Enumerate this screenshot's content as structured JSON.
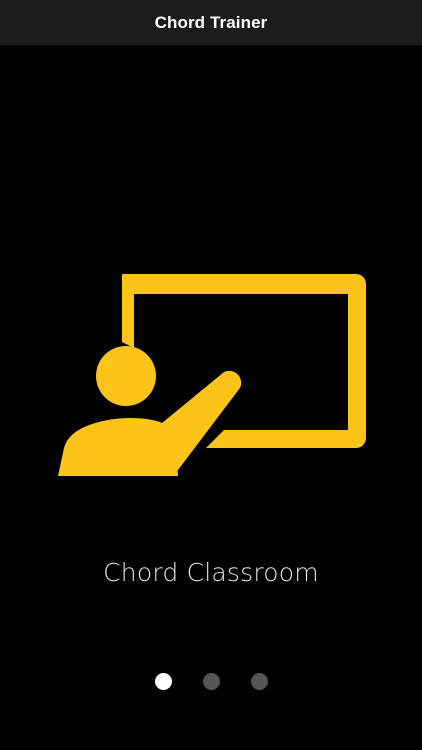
{
  "nav": {
    "title": "Chord Trainer"
  },
  "slide": {
    "icon": "teacher-at-whiteboard-icon",
    "caption": "Chord Classroom"
  },
  "pager": {
    "total": 3,
    "current": 1
  },
  "colors": {
    "background": "#000000",
    "nav_background": "#1c1c1c",
    "accent": "#fcc419",
    "dot_active": "#ffffff",
    "dot_inactive": "#555555"
  }
}
